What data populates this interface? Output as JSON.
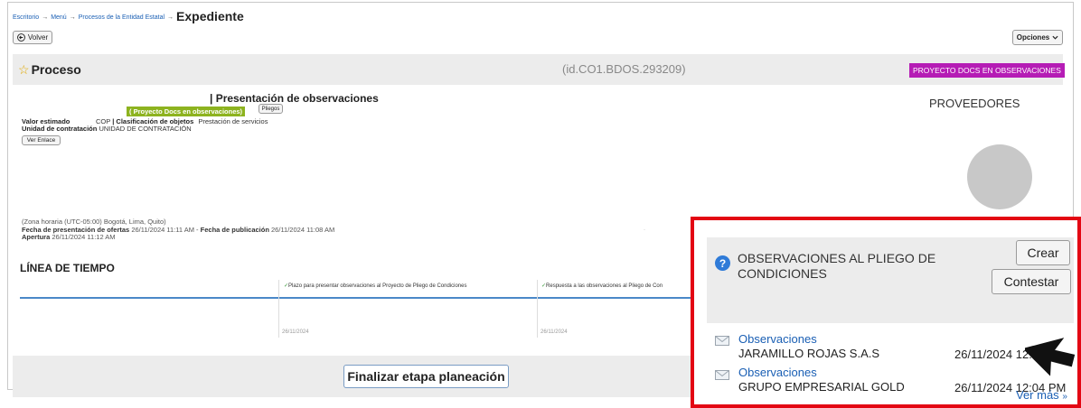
{
  "breadcrumb": {
    "items": [
      "Escritorio",
      "Menú",
      "Procesos de la Entidad Estatal"
    ],
    "separator": "→",
    "current": "Expediente"
  },
  "buttons": {
    "volver": "Volver",
    "opciones": "Opciones",
    "pliegos": "Pliegos",
    "ver_enlace": "Ver Enlace",
    "finalizar": "Finalizar etapa planeación"
  },
  "proceso": {
    "title": "Proceso",
    "id": "(id.CO1.BDOS.293209)",
    "status_badge": "PROYECTO DOCS EN OBSERVACIONES",
    "subtitle": "| Presentación de observaciones",
    "tag": "( Proyecto Docs en observaciones)",
    "valor_label": "Valor estimado",
    "valor_value": "COP",
    "clasificacion_label": "| Clasificación de objetos",
    "clasificacion_value": "Prestación de servicios",
    "unidad_label": "Unidad de contratación",
    "unidad_value": "UNIDAD DE CONTRATACIÓN"
  },
  "proveedores": "PROVEEDORES",
  "dates": {
    "zona": "(Zona horaria (UTC-05:00) Bogotá, Lima, Quito)",
    "presentacion_label": "Fecha de presentación de ofertas",
    "presentacion_value": "26/11/2024 11:11 AM",
    "dash": "-",
    "publicacion_label": "Fecha de publicación",
    "publicacion_value": "26/11/2024 11:08 AM",
    "apertura_label": "Apertura",
    "apertura_value": "26/11/2024 11:12 AM"
  },
  "timeline": {
    "title": "LÍNEA DE TIEMPO",
    "check": "✓",
    "steps": [
      {
        "label": "Plazo para presentar observaciones al Proyecto de Pliego de Condiciones",
        "date": "26/11/2024"
      },
      {
        "label": "Respuesta a las observaciones al Pliego de Con",
        "date": "26/11/2024"
      }
    ]
  },
  "observaciones_panel": {
    "title": "OBSERVACIONES AL PLIEGO DE CONDICIONES",
    "crear": "Crear",
    "contestar": "Contestar",
    "items": [
      {
        "link": "Observaciones",
        "name": "JARAMILLO ROJAS S.A.S",
        "date": "26/11/2024 12:"
      },
      {
        "link": "Observaciones",
        "name": "GRUPO EMPRESARIAL GOLD",
        "date": "26/11/2024 12:04 PM"
      }
    ],
    "ver_mas": "Ver más",
    "ver_mas_arrow": "»"
  },
  "colors": {
    "badge": "#b51cb5",
    "tag": "#8db31f",
    "highlight_border": "#e30613",
    "link": "#1a5fb4"
  }
}
